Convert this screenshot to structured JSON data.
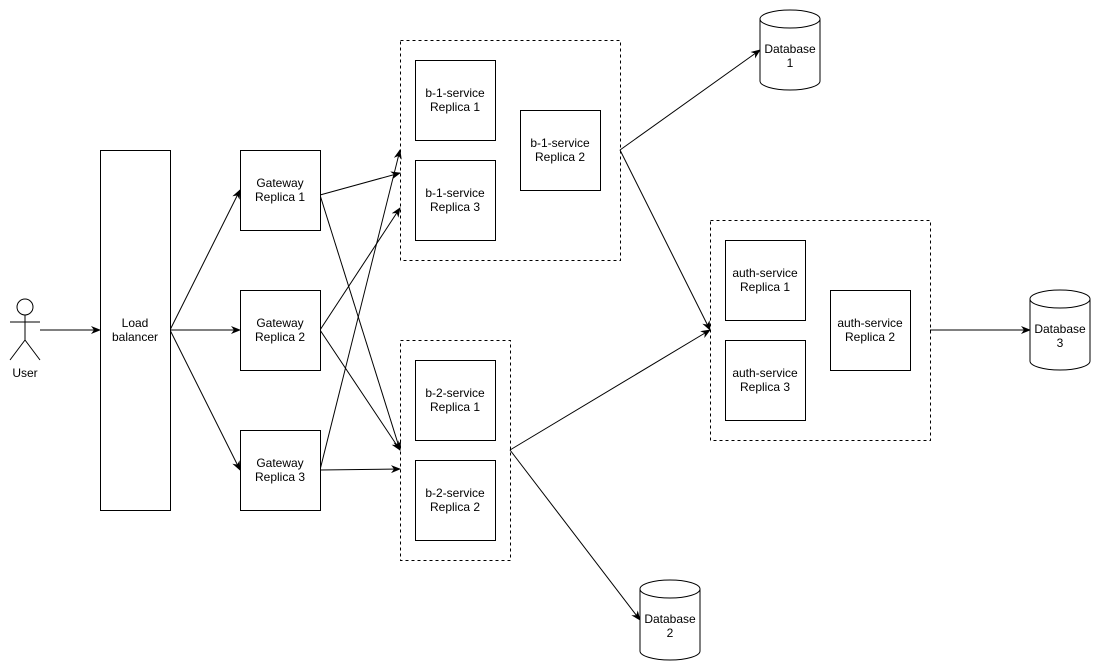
{
  "user": {
    "label": "User"
  },
  "load_balancer": {
    "line1": "Load",
    "line2": "balancer"
  },
  "gateways": [
    {
      "line1": "Gateway",
      "line2": "Replica 1"
    },
    {
      "line1": "Gateway",
      "line2": "Replica 2"
    },
    {
      "line1": "Gateway",
      "line2": "Replica 3"
    }
  ],
  "b1_service": [
    {
      "line1": "b-1-service",
      "line2": "Replica 1"
    },
    {
      "line1": "b-1-service",
      "line2": "Replica 3"
    },
    {
      "line1": "b-1-service",
      "line2": "Replica 2"
    }
  ],
  "b2_service": [
    {
      "line1": "b-2-service",
      "line2": "Replica 1"
    },
    {
      "line1": "b-2-service",
      "line2": "Replica 2"
    }
  ],
  "auth_service": [
    {
      "line1": "auth-service",
      "line2": "Replica 1"
    },
    {
      "line1": "auth-service",
      "line2": "Replica 3"
    },
    {
      "line1": "auth-service",
      "line2": "Replica 2"
    }
  ],
  "databases": [
    {
      "line1": "Database",
      "line2": "1"
    },
    {
      "line1": "Database",
      "line2": "2"
    },
    {
      "line1": "Database",
      "line2": "3"
    }
  ],
  "colors": {
    "stroke": "#000000",
    "background": "#ffffff"
  }
}
